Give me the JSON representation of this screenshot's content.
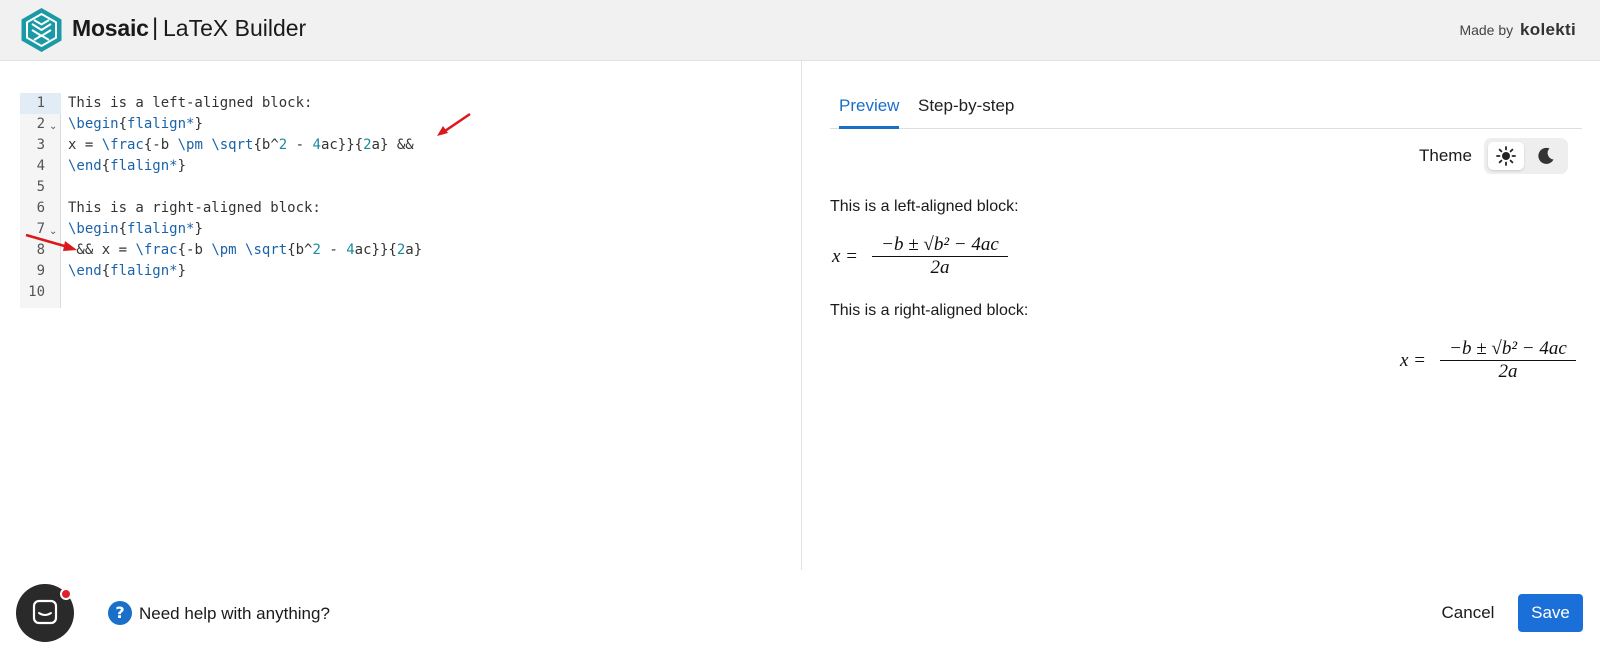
{
  "header": {
    "app_name": "Mosaic",
    "separator": "|",
    "app_subtitle": "LaTeX Builder",
    "made_by_label": "Made by",
    "made_by_brand": "kolekti"
  },
  "editor": {
    "line_numbers": [
      "1",
      "2",
      "3",
      "4",
      "5",
      "6",
      "7",
      "8",
      "9",
      "10"
    ],
    "lines": [
      "This is a left-aligned block:",
      "\\begin{flalign*}",
      "x = \\frac{-b \\pm \\sqrt{b^2 - 4ac}}{2a} &&",
      "\\end{flalign*}",
      "",
      "This is a right-aligned block:",
      "\\begin{flalign*}",
      " && x = \\frac{-b \\pm \\sqrt{b^2 - 4ac}}{2a}",
      "\\end{flalign*}",
      ""
    ],
    "foldable_lines": [
      2,
      7
    ]
  },
  "tabs": [
    {
      "label": "Preview",
      "active": true
    },
    {
      "label": "Step-by-step",
      "active": false
    }
  ],
  "theme": {
    "label": "Theme",
    "options": [
      "light-icon",
      "dark-icon"
    ],
    "selected": "light"
  },
  "preview": {
    "block1_text": "This is a left-aligned block:",
    "block2_text": "This is a right-aligned block:",
    "formula": {
      "lhs": "x =",
      "numerator": "−b ± √b² − 4ac",
      "denominator": "2a"
    }
  },
  "footer": {
    "help_text": "Need help with anything?",
    "cancel_label": "Cancel",
    "save_label": "Save"
  },
  "colors": {
    "accent": "#1a6fc9",
    "save_button": "#1a6fd9",
    "header_bg": "#f1f1f1",
    "annotation_arrow": "#d9191c"
  }
}
